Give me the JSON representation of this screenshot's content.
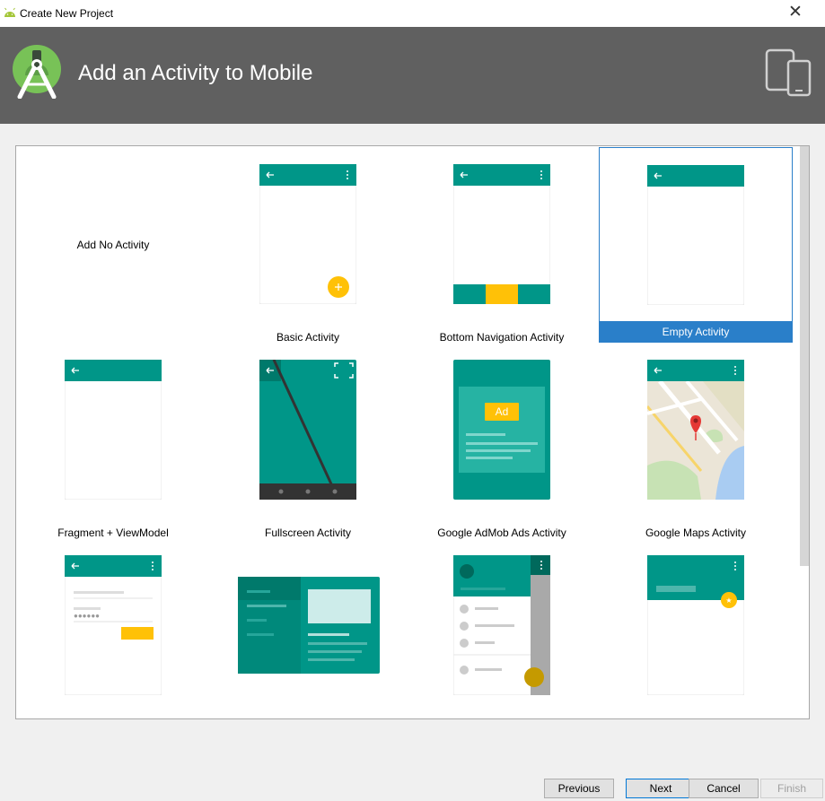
{
  "window": {
    "title": "Create New Project"
  },
  "header": {
    "heading": "Add an Activity to Mobile"
  },
  "gallery": {
    "items": [
      {
        "label": "Add No Activity"
      },
      {
        "label": "Basic Activity"
      },
      {
        "label": "Bottom Navigation Activity"
      },
      {
        "label": "Empty Activity",
        "selected": true
      },
      {
        "label": "Fragment + ViewModel"
      },
      {
        "label": "Fullscreen Activity"
      },
      {
        "label": "Google AdMob Ads Activity",
        "ad_badge": "Ad"
      },
      {
        "label": "Google Maps Activity"
      },
      {
        "label": ""
      },
      {
        "label": ""
      },
      {
        "label": ""
      },
      {
        "label": ""
      }
    ]
  },
  "buttons": {
    "previous": "Previous",
    "next": "Next",
    "cancel": "Cancel",
    "finish": "Finish"
  },
  "colors": {
    "teal": "#009688",
    "teal_dark": "#00796b",
    "amber": "#ffc107",
    "header_bg": "#606060",
    "selection": "#2a7fc9"
  },
  "icons": [
    "android-icon",
    "android-studio-logo",
    "close-icon",
    "devices-icon",
    "back-arrow-icon",
    "overflow-menu-icon",
    "fab-add-icon",
    "fullscreen-icon",
    "map-pin-icon",
    "star-icon"
  ]
}
